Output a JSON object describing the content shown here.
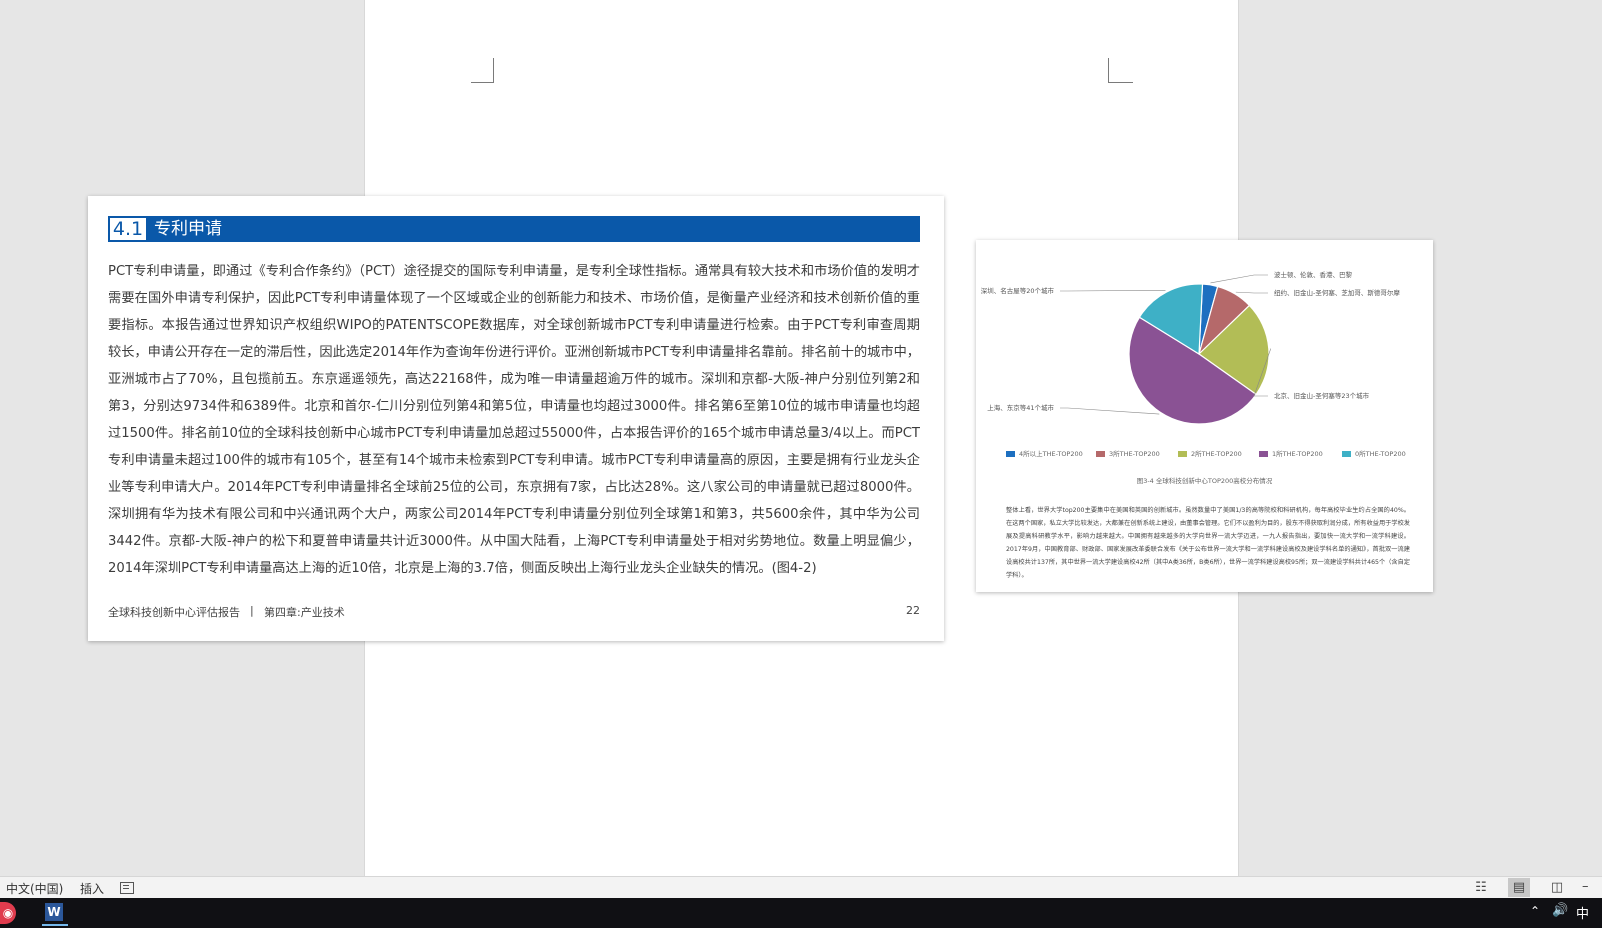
{
  "report": {
    "section_number": "4.1",
    "section_title": "专利申请",
    "body": "PCT专利申请量，即通过《专利合作条约》（PCT）途径提交的国际专利申请量，是专利全球性指标。通常具有较大技术和市场价值的发明才需要在国外申请专利保护，因此PCT专利申请量体现了一个区域或企业的创新能力和技术、市场价值，是衡量产业经济和技术创新价值的重要指标。本报告通过世界知识产权组织WIPO的PATENTSCOPE数据库，对全球创新城市PCT专利申请量进行检索。由于PCT专利审查周期较长，申请公开存在一定的滞后性，因此选定2014年作为查询年份进行评价。亚洲创新城市PCT专利申请量排名靠前。排名前十的城市中，亚洲城市占了70%，且包揽前五。东京遥遥领先，高达22168件，成为唯一申请量超逾万件的城市。深圳和京都-大阪-神户分别位列第2和第3，分别达9734件和6389件。北京和首尔-仁川分别位列第4和第5位，申请量也均超过3000件。排名第6至第10位的城市申请量也均超过1500件。排名前10位的全球科技创新中心城市PCT专利申请量加总超过55000件，占本报告评价的165个城市申请总量3/4以上。而PCT专利申请量未超过100件的城市有105个，甚至有14个城市未检索到PCT专利申请。城市PCT专利申请量高的原因，主要是拥有行业龙头企业等专利申请大户。2014年PCT专利申请量排名全球前25位的公司，东京拥有7家，占比达28%。这八家公司的申请量就已超过8000件。深圳拥有华为技术有限公司和中兴通讯两个大户，两家公司2014年PCT专利申请量分别位列全球第1和第3，共5600余件，其中华为公司3442件。京都-大阪-神户的松下和夏普申请量共计近3000件。从中国大陆看，上海PCT专利申请量处于相对劣势地位。数量上明显偏少，2014年深圳PCT专利申请量高达上海的近10倍，北京是上海的3.7倍，侧面反映出上海行业龙头企业缺失的情况。(图4-2)",
    "footer_title": "全球科技创新中心评估报告",
    "footer_separator": "|",
    "footer_chapter": "第四章:产业技术",
    "page_number": "22"
  },
  "chart_data": {
    "type": "pie",
    "title": "图3-4 全球科技创新中心TOP200高校分布情况",
    "series": [
      {
        "name": "4所以上THE-TOP200",
        "value": 3.5,
        "color": "#1d6fc0"
      },
      {
        "name": "3所THE-TOP200",
        "value": 8.5,
        "color": "#b5696a"
      },
      {
        "name": "2所THE-TOP200",
        "value": 22,
        "color": "#b2bd56"
      },
      {
        "name": "1所THE-TOP200",
        "value": 49,
        "color": "#8a5294"
      },
      {
        "name": "0所THE-TOP200",
        "value": 17,
        "color": "#3eb0c6"
      }
    ],
    "slice_labels": [
      "波士顿、伦敦、香港、巴黎",
      "纽约、旧金山-圣何塞、芝加哥、斯德哥尔摩",
      "北京、旧金山-圣何塞等23个城市",
      "上海、东京等41个城市",
      "深圳、名古屋等20个城市"
    ],
    "legend_position": "bottom"
  },
  "chart_page": {
    "paragraph": "整体上看，世界大学top200主要集中在美国和英国的创新城市。虽然数量中了美国1/3的高等院校和科研机构，每年高校毕业生约占全国的40%。在这两个国家，私立大学比较发达，大都兼在创新系统上建设，由董事会管理。它们不以盈利为目的，股东不得获取利润分成，所有收益用于学校发展及提高科研教学水平，影响力越来越大。中国拥有越来越多的大学向世界一流大学迈进，一九人报告指出，要加快一流大学和一流学科建设。2017年9月，中国教育部、财政部、国家发展改革委联合发布《关于公布世界一流大学和一流学科建设高校及建设学科名单的通知》，首批双一流建设高校共计137所，其中世界一流大学建设高校42所（其中A类36所，B类6所），世界一流学科建设高校95所；双一流建设学科共计465个（含自定学科）。"
  },
  "status_bar": {
    "language": "中文(中国)",
    "mode": "插入"
  },
  "taskbar": {
    "ime": "中",
    "word_letter": "W"
  },
  "colors": {
    "accent": "#0a58a9"
  }
}
